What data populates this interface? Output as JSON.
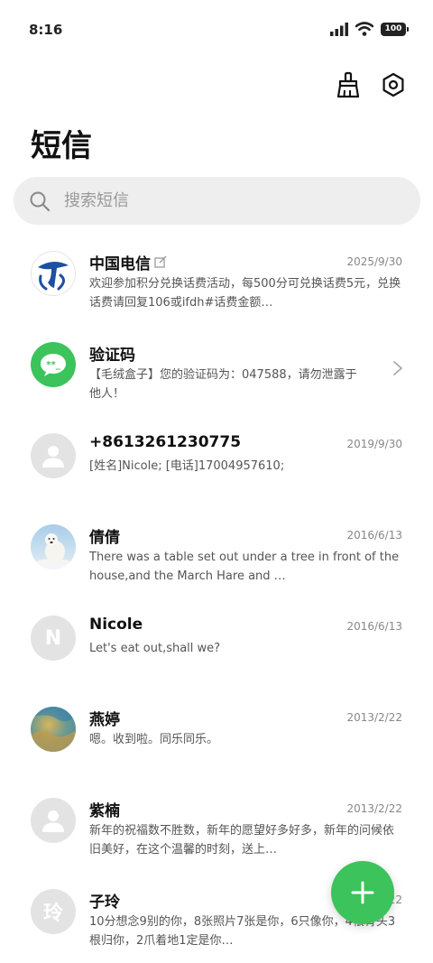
{
  "status_bar": {
    "time": "8:16",
    "battery": "100",
    "icons": [
      "signal-icon",
      "wifi-icon",
      "battery-icon"
    ]
  },
  "toolbar": {
    "icons": [
      "broom-icon",
      "gear-icon"
    ]
  },
  "page_title": "短信",
  "search": {
    "placeholder": "搜索短信",
    "value": ""
  },
  "messages": [
    {
      "name": "中国电信",
      "date": "2025/9/30",
      "preview": "欢迎参加积分兑换话费活动，每500分可兑换话费5元，兑换话费请回复106或ifdh#话费金额…",
      "avatar_initial": ""
    },
    {
      "name": "验证码",
      "date": "",
      "preview": "【毛绒盒子】您的验证码为：047588，请勿泄露于他人！",
      "avatar_initial": ""
    },
    {
      "name": "+8613261230775",
      "date": "2019/9/30",
      "preview": "[姓名]Nicole; [电话]17004957610;",
      "avatar_initial": ""
    },
    {
      "name": "倩倩",
      "date": "2016/6/13",
      "preview": "There was a table set out under a tree in front of the house,and the March Hare and …",
      "avatar_initial": ""
    },
    {
      "name": "Nicole",
      "date": "2016/6/13",
      "preview": "Let's eat out,shall we?",
      "avatar_initial": "N"
    },
    {
      "name": "燕婷",
      "date": "2013/2/22",
      "preview": "嗯。收到啦。同乐同乐。",
      "avatar_initial": ""
    },
    {
      "name": "紫楠",
      "date": "2013/2/22",
      "preview": "新年的祝福数不胜数，新年的愿望好多好多，新年的问候依旧美好，在这个温馨的时刻，送上…",
      "avatar_initial": ""
    },
    {
      "name": "子玲",
      "date": "2013/2/22",
      "preview": "10分想念9别的你，8张照片7张是你，6只像你，4根骨头3根归你，2爪着地1定是你…",
      "avatar_initial": "玲"
    }
  ],
  "colors": {
    "accent": "#3cc35c",
    "telecom_blue": "#1d4fa3",
    "avatar_gray": "#e3e3e3"
  },
  "fab": {
    "icon": "plus-icon"
  }
}
